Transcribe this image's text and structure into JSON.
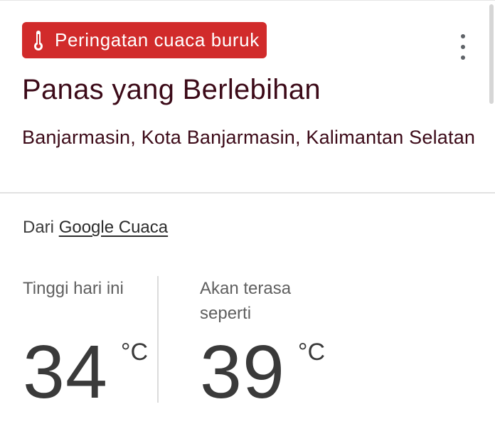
{
  "alert": {
    "icon": "thermometer-icon",
    "label": "Peringatan cuaca buruk",
    "color": "#d12b2b"
  },
  "title": "Panas yang Berlebihan",
  "location": "Banjarmasin, Kota Banjarmasin, Kalimantan Selatan",
  "source": {
    "prefix": "Dari",
    "link": "Google Cuaca"
  },
  "temperatures": {
    "high": {
      "label": "Tinggi hari ini",
      "value": "34",
      "unit": "°C"
    },
    "feels_like": {
      "label": "Akan terasa seperti",
      "value": "39",
      "unit": "°C"
    }
  },
  "menu": {
    "icon": "more-vert-icon"
  }
}
